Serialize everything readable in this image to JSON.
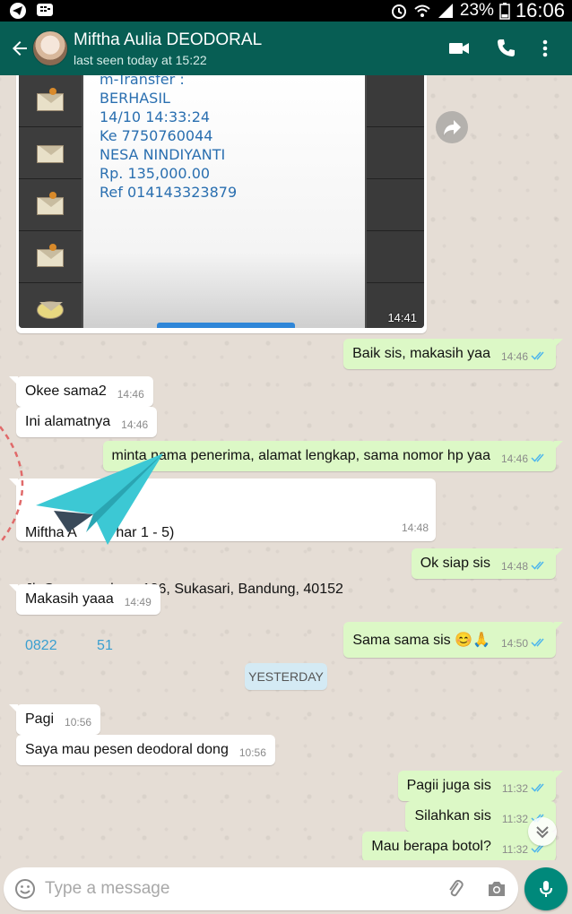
{
  "status_bar": {
    "battery": "23%",
    "time": "16:06",
    "icons": [
      "telegram-icon",
      "bbm-icon",
      "alarm-icon",
      "wifi-icon",
      "signal-icon",
      "battery-icon"
    ]
  },
  "header": {
    "contact_name": "Miftha Aulia DEODORAL",
    "last_seen": "last seen today at 15:22",
    "icons": [
      "back-arrow-icon",
      "video-call-icon",
      "phone-icon",
      "more-vert-icon"
    ]
  },
  "colors": {
    "header": "#075e54",
    "outgoing": "#dcf8c6",
    "incoming": "#ffffff",
    "chat_bg": "#e5ddd5",
    "accent": "#00897b",
    "link": "#3a9fd0"
  },
  "image_message": {
    "lines": [
      "m-Transfer :",
      "BERHASIL",
      "14/10 14:33:24",
      "Ke 7750760044",
      "NESA NINDIYANTI",
      "Rp. 135,000.00",
      "Ref 014143323879"
    ],
    "time": "14:41"
  },
  "messages": {
    "m1": {
      "text": "Baik sis, makasih yaa",
      "time": "14:46"
    },
    "m2": {
      "text": "Okee sama2",
      "time": "14:46"
    },
    "m3": {
      "text": "Ini alamatnya",
      "time": "14:46"
    },
    "m4": {
      "text": "minta nama penerima, alamat lengkap, sama nomor hp yaa",
      "time": "14:46"
    },
    "m5": {
      "line1": "Miftha A          har 1 - 5)",
      "line2": "Jl. G          gah no 186, Sukasari, Bandung, 40152",
      "line3": "0822          51",
      "time": "14:48"
    },
    "m6": {
      "text": "Ok siap sis",
      "time": "14:48"
    },
    "m7": {
      "text": "Makasih yaaa",
      "time": "14:49"
    },
    "m8": {
      "text": "Sama sama sis 😊🙏",
      "time": "14:50"
    },
    "m9": {
      "text": "Pagi",
      "time": "10:56"
    },
    "m10": {
      "text": "Saya mau pesen deodoral dong",
      "time": "10:56"
    },
    "m11": {
      "text": "Pagii juga sis",
      "time": "11:32"
    },
    "m12": {
      "text": "Silahkan sis",
      "time": "11:32"
    },
    "m13": {
      "text": "Mau berapa botol?",
      "time": "11:32"
    }
  },
  "date_divider": "YESTERDAY",
  "composer": {
    "placeholder": "Type a message",
    "icons": [
      "emoji-icon",
      "attach-icon",
      "camera-icon",
      "mic-icon"
    ]
  }
}
